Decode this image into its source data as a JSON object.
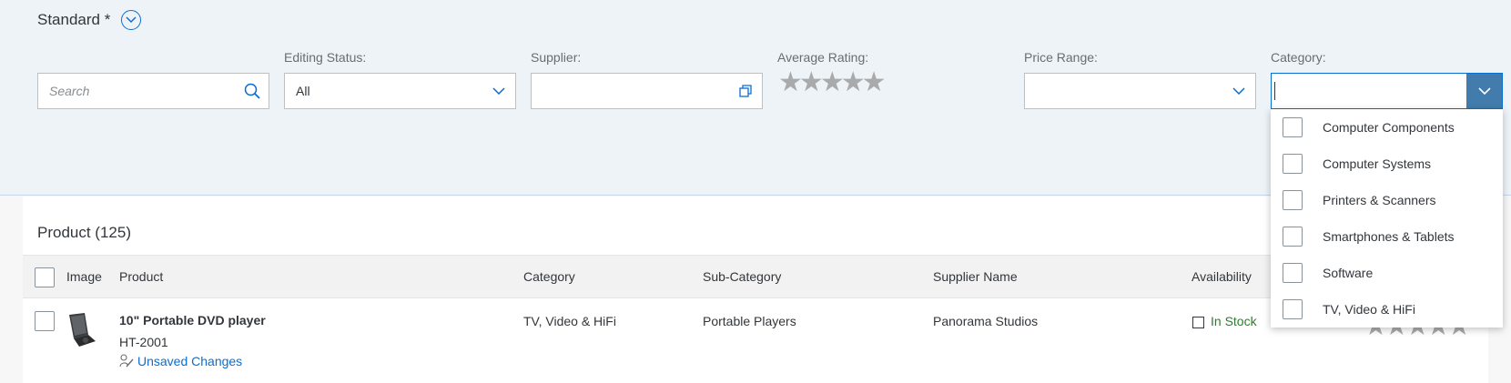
{
  "filter_bar": {
    "variant_title": "Standard *",
    "search": {
      "placeholder": "Search",
      "value": ""
    },
    "editing_status": {
      "label": "Editing Status:",
      "value": "All"
    },
    "supplier": {
      "label": "Supplier:",
      "value": ""
    },
    "average_rating": {
      "label": "Average Rating:",
      "stars_filled": 0,
      "stars_total": 5
    },
    "price_range": {
      "label": "Price Range:",
      "value": ""
    },
    "category": {
      "label": "Category:",
      "value": ""
    }
  },
  "category_dropdown": {
    "options": [
      {
        "label": "Computer Components",
        "checked": false
      },
      {
        "label": "Computer Systems",
        "checked": false
      },
      {
        "label": "Printers & Scanners",
        "checked": false
      },
      {
        "label": "Smartphones & Tablets",
        "checked": false
      },
      {
        "label": "Software",
        "checked": false
      },
      {
        "label": "TV, Video & HiFi",
        "checked": false
      }
    ]
  },
  "table": {
    "title": "Product (125)",
    "columns": [
      "Image",
      "Product",
      "Category",
      "Sub-Category",
      "Supplier Name",
      "Availability"
    ],
    "rows": [
      {
        "product_name": "10\" Portable DVD player",
        "product_id": "HT-2001",
        "status": "Unsaved Changes",
        "category": "TV, Video & HiFi",
        "sub_category": "Portable Players",
        "supplier_name": "Panorama Studios",
        "availability": "In Stock",
        "rating_stars_filled": 0,
        "rating_stars_total": 5
      }
    ]
  },
  "colors": {
    "accent": "#0a6ed1",
    "filter_bar_bg": "#eef3f8",
    "success": "#2b7d2b",
    "star_gray": "#a8aaac"
  }
}
